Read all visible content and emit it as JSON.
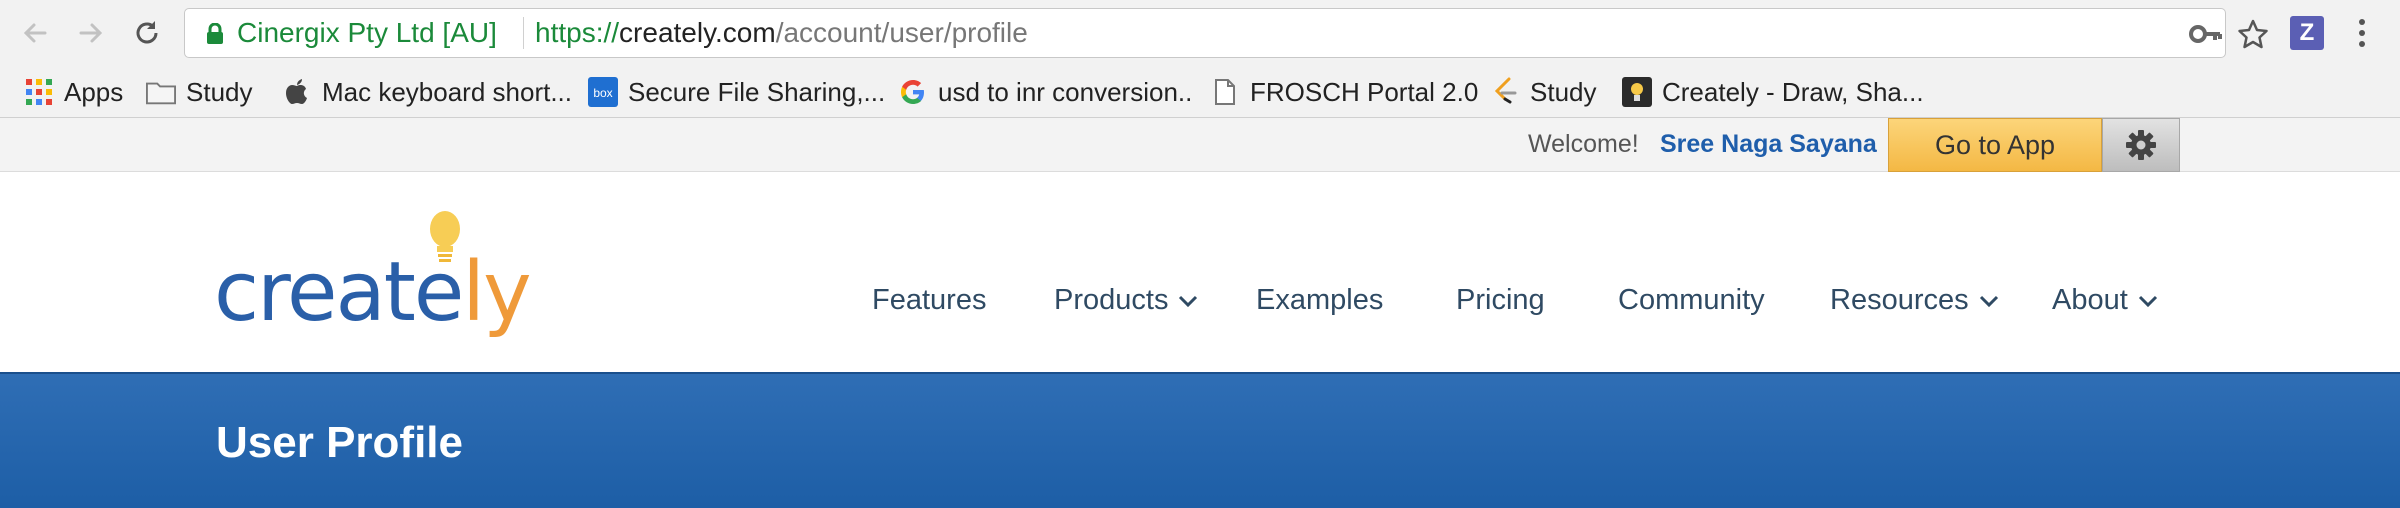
{
  "browser": {
    "site_identity": "Cinergix Pty Ltd [AU]",
    "url_scheme": "https://",
    "url_host": "creately.com",
    "url_path": "/account/user/profile",
    "extension_label": "Z"
  },
  "bookmarks": [
    {
      "label": "Apps",
      "icon": "apps-grid-icon"
    },
    {
      "label": "Study",
      "icon": "folder-icon"
    },
    {
      "label": "Mac keyboard short...",
      "icon": "apple-icon"
    },
    {
      "label": "Secure File Sharing,...",
      "icon": "box-icon"
    },
    {
      "label": "usd to inr conversion..",
      "icon": "google-icon"
    },
    {
      "label": "FROSCH Portal 2.0",
      "icon": "page-icon"
    },
    {
      "label": "Study",
      "icon": "leetcode-icon"
    },
    {
      "label": "Creately - Draw, Sha...",
      "icon": "creately-icon"
    }
  ],
  "account_bar": {
    "welcome": "Welcome!",
    "user_name": "Sree Naga Sayana",
    "go_to_app": "Go to App"
  },
  "nav": {
    "items": [
      {
        "label": "Features",
        "dropdown": false
      },
      {
        "label": "Products",
        "dropdown": true
      },
      {
        "label": "Examples",
        "dropdown": false
      },
      {
        "label": "Pricing",
        "dropdown": false
      },
      {
        "label": "Community",
        "dropdown": false
      },
      {
        "label": "Resources",
        "dropdown": true
      },
      {
        "label": "About",
        "dropdown": true
      }
    ]
  },
  "logo": {
    "text": "creately"
  },
  "banner": {
    "title": "User Profile"
  },
  "colors": {
    "brand_blue": "#2a5fa8",
    "accent_orange": "#ef9a3a",
    "button_yellow": "#f6c15a",
    "banner_blue": "#1d5ea6",
    "secure_green": "#1b8a3a"
  }
}
